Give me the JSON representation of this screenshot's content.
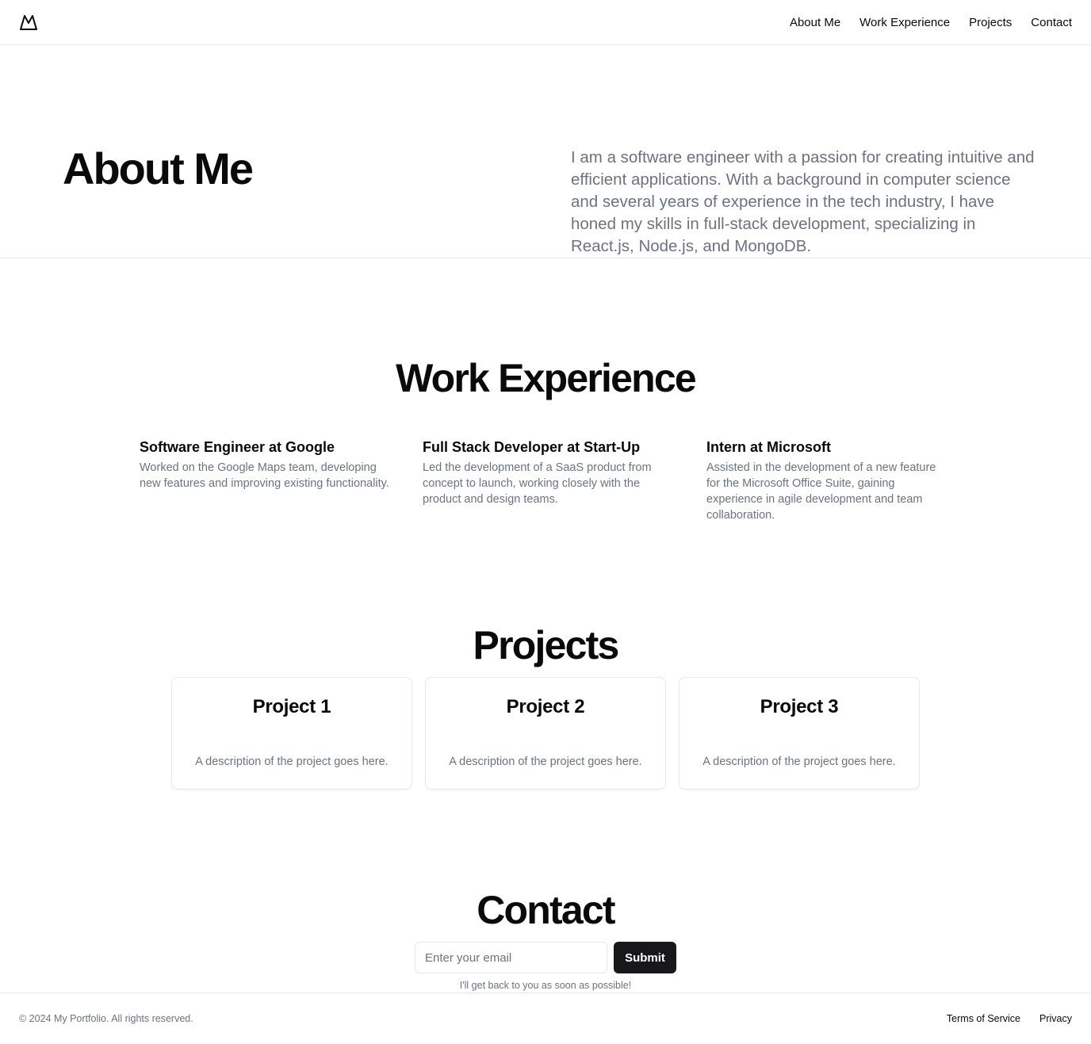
{
  "header": {
    "logo_icon": "mountain-icon",
    "nav": [
      {
        "label": "About Me"
      },
      {
        "label": "Work Experience"
      },
      {
        "label": "Projects"
      },
      {
        "label": "Contact"
      }
    ]
  },
  "about": {
    "title": "About Me",
    "text": "I am a software engineer with a passion for creating intuitive and efficient applications. With a background in computer science and several years of experience in the tech industry, I have honed my skills in full-stack development, specializing in React.js, Node.js, and MongoDB."
  },
  "work": {
    "title": "Work Experience",
    "jobs": [
      {
        "title": "Software Engineer at Google",
        "description": "Worked on the Google Maps team, developing new features and improving existing functionality."
      },
      {
        "title": "Full Stack Developer at Start-Up",
        "description": "Led the development of a SaaS product from concept to launch, working closely with the product and design teams."
      },
      {
        "title": "Intern at Microsoft",
        "description": "Assisted in the development of a new feature for the Microsoft Office Suite, gaining experience in agile development and team collaboration."
      }
    ]
  },
  "projects": {
    "title": "Projects",
    "items": [
      {
        "title": "Project 1",
        "description": "A description of the project goes here."
      },
      {
        "title": "Project 2",
        "description": "A description of the project goes here."
      },
      {
        "title": "Project 3",
        "description": "A description of the project goes here."
      }
    ]
  },
  "contact": {
    "title": "Contact",
    "email_placeholder": "Enter your email",
    "email_value": "",
    "submit_label": "Submit",
    "note": "I'll get back to you as soon as possible!"
  },
  "footer": {
    "copyright": "© 2024 My Portfolio. All rights reserved.",
    "links": [
      {
        "label": "Terms of Service"
      },
      {
        "label": "Privacy"
      }
    ]
  },
  "colors": {
    "text": "#0a0a0a",
    "muted": "#6b7280",
    "border": "#e5e7eb",
    "button": "#18181b"
  }
}
